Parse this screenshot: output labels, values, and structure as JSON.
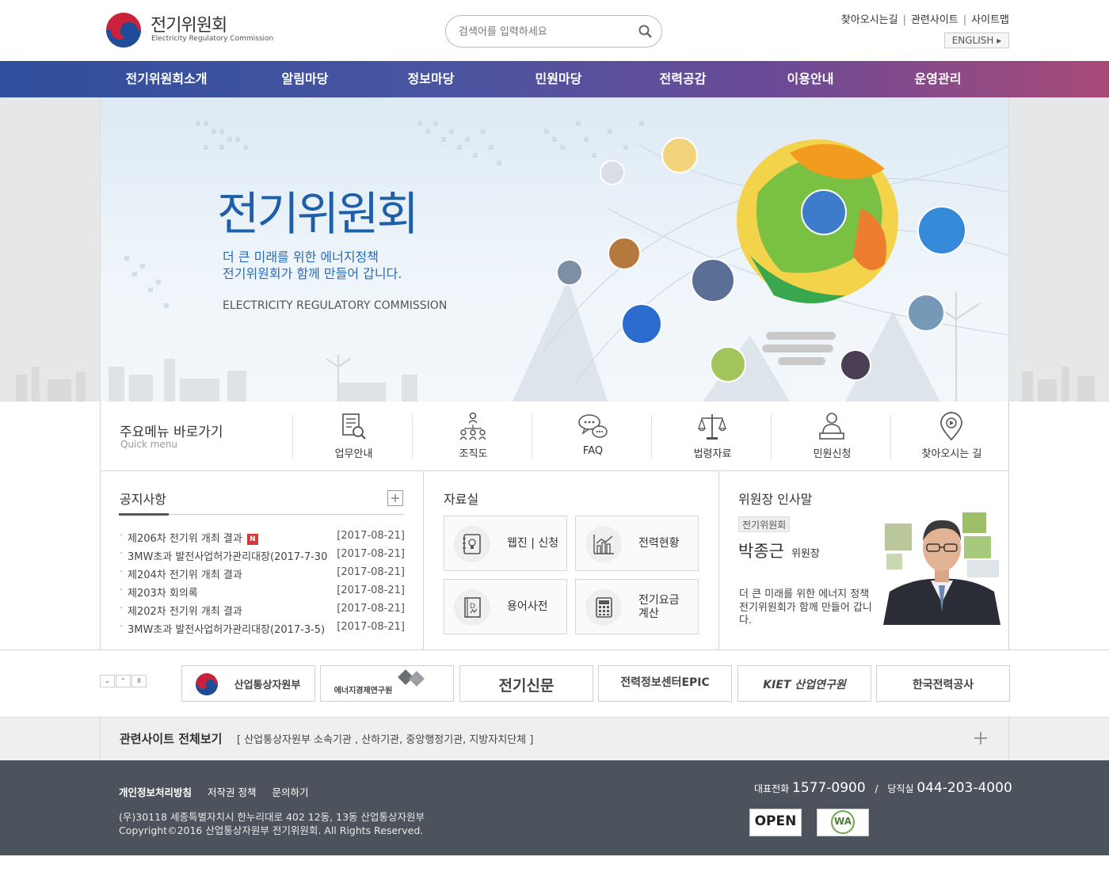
{
  "header": {
    "logo_title": "전기위원회",
    "logo_subtitle": "Electricity Regulatory Commission",
    "search_placeholder": "검색어를 입력하세요",
    "top_links": [
      "찾아오시는길",
      "관련사이트",
      "사이트맵"
    ],
    "english_label": "ENGLISH ▸"
  },
  "gnb": [
    "전기위원회소개",
    "알림마당",
    "정보마당",
    "민원마당",
    "전력공감",
    "이용안내",
    "운영관리"
  ],
  "hero": {
    "title": "전기위원회",
    "sub1": "더 큰 미래를 위한 에너지정책",
    "sub2": "전기위원회가 함께 만들어 갑니다.",
    "en": "ELECTRICITY REGULATORY COMMISSION"
  },
  "quick_menu": {
    "title": "주요메뉴 바로가기",
    "subtitle": "Quick menu",
    "items": [
      {
        "label": "업무안내",
        "icon": "document-search-icon"
      },
      {
        "label": "조직도",
        "icon": "org-chart-icon"
      },
      {
        "label": "FAQ",
        "icon": "chat-bubble-icon"
      },
      {
        "label": "법령자료",
        "icon": "scale-icon"
      },
      {
        "label": "민원신청",
        "icon": "person-desk-icon"
      },
      {
        "label": "찾아오시는 길",
        "icon": "map-pin-icon"
      }
    ]
  },
  "notice": {
    "title": "공지사항",
    "items": [
      {
        "title": "제206차 전기위 개최 결과",
        "date": "[2017-08-21]",
        "badge": "N"
      },
      {
        "title": "3MW초과 발전사업허가관리대장(2017-7-30",
        "date": "[2017-08-21]"
      },
      {
        "title": "제204차 전기위 개최 결과",
        "date": "[2017-08-21]"
      },
      {
        "title": "제203차 회의록",
        "date": "[2017-08-21]"
      },
      {
        "title": "제202차 전기위 개최 결과",
        "date": "[2017-08-21]"
      },
      {
        "title": "3MW초과 발전사업허가관리대장(2017-3-5)",
        "date": "[2017-08-21]"
      }
    ]
  },
  "library": {
    "title": "자료실",
    "items": [
      {
        "label": "웹진 | 신청",
        "icon": "webzine-icon"
      },
      {
        "label": "전력현황",
        "icon": "bar-chart-icon"
      },
      {
        "label": "용어사전",
        "icon": "dictionary-icon"
      },
      {
        "label": "전기요금",
        "label2": "계산",
        "icon": "calculator-icon"
      }
    ]
  },
  "greeting": {
    "title": "위원장 인사말",
    "tag": "전기위원회",
    "name": "박종근",
    "role": "위원장",
    "message": "더 큰 미래를 위한 에너지 정책 전기위원회가 함께 만들어 갑니다."
  },
  "banner_controls": [
    "⌄",
    "⌃",
    "II"
  ],
  "banners": [
    "산업통상자원부",
    "에너지경제연구원",
    "전기신문",
    "전력정보센터EPIC",
    "KIET 산업연구원",
    "한국전력공사"
  ],
  "related": {
    "title": "관련사이트 전체보기",
    "desc": "[ 산업통상자원부 소속기관 , 산하기관, 중앙행정기관, 지방자치단체 ]"
  },
  "footer": {
    "links": [
      "개인정보처리방침",
      "저작권 정책",
      "문의하기"
    ],
    "address": "(우)30118 세종특별자치시 한누리대로 402 12동, 13동 산업통상자원부",
    "copyright": "Copyright©2016 산업통상자원부 전기위원회. All Rights Reserved.",
    "tel_label": "대표전화",
    "tel": "1577-0900",
    "duty_label": "당직실",
    "duty": "044-203-4000",
    "open_label": "OPEN",
    "wa_label": "WA"
  },
  "colors": {
    "accent_blue": "#1d5fa8",
    "gnb_start": "#2f4f9c",
    "gnb_end": "#a84a78",
    "footer": "#4d535c",
    "badge_red": "#d8383b"
  }
}
